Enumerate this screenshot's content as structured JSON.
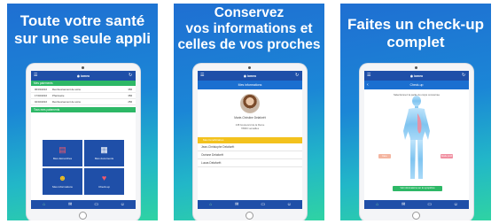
{
  "panels": [
    {
      "headline": "Toute votre santé\nsur une seule appli",
      "app": {
        "logo": "iomeo",
        "section_bar": "Mes paiements",
        "rows": [
          {
            "date": "06/03/2016",
            "label": "Remboursement de soins",
            "amount": "35€"
          },
          {
            "date": "17/02/2016",
            "label": "Pharmacie",
            "amount": "35€"
          },
          {
            "date": "02/02/2016",
            "label": "Remboursement de soins",
            "amount": "25€"
          }
        ],
        "see_all": "Tous mes paiements",
        "tiles": [
          {
            "label": "Mes démarches",
            "icon": "document-icon"
          },
          {
            "label": "Mes documents",
            "icon": "folder-icon"
          },
          {
            "label": "Mes informations",
            "icon": "person-icon"
          },
          {
            "label": "Check-up",
            "icon": "heartbeat-icon"
          }
        ]
      }
    },
    {
      "headline": "Conservez\nvos informations et\ncelles de vos proches",
      "app": {
        "logo": "iomeo",
        "subtitle": "Mes informations",
        "user_name": "Marie-Christine Delaforêt",
        "address": [
          "138 boulevard de la Reine",
          "78000 versailles"
        ],
        "section_bar": "Mes bénéficiaires",
        "people": [
          "Jean-Christophe Delaforêt",
          "Océane Delaforêt",
          "Lucas Delaforêt"
        ]
      }
    },
    {
      "headline": "Faites un check-up\ncomplet",
      "app": {
        "logo": "iomeo",
        "title": "Check-up",
        "instruction": "Sélectionnez la partie du corps concernée",
        "left_button": "Face",
        "right_button": "Dos/le profil",
        "bottom_button": "Voir informations sur le symptôme"
      }
    }
  ],
  "colors": {
    "app_blue": "#1f4fa8",
    "accent_green": "#2db866",
    "accent_yellow": "#f3c21d"
  }
}
